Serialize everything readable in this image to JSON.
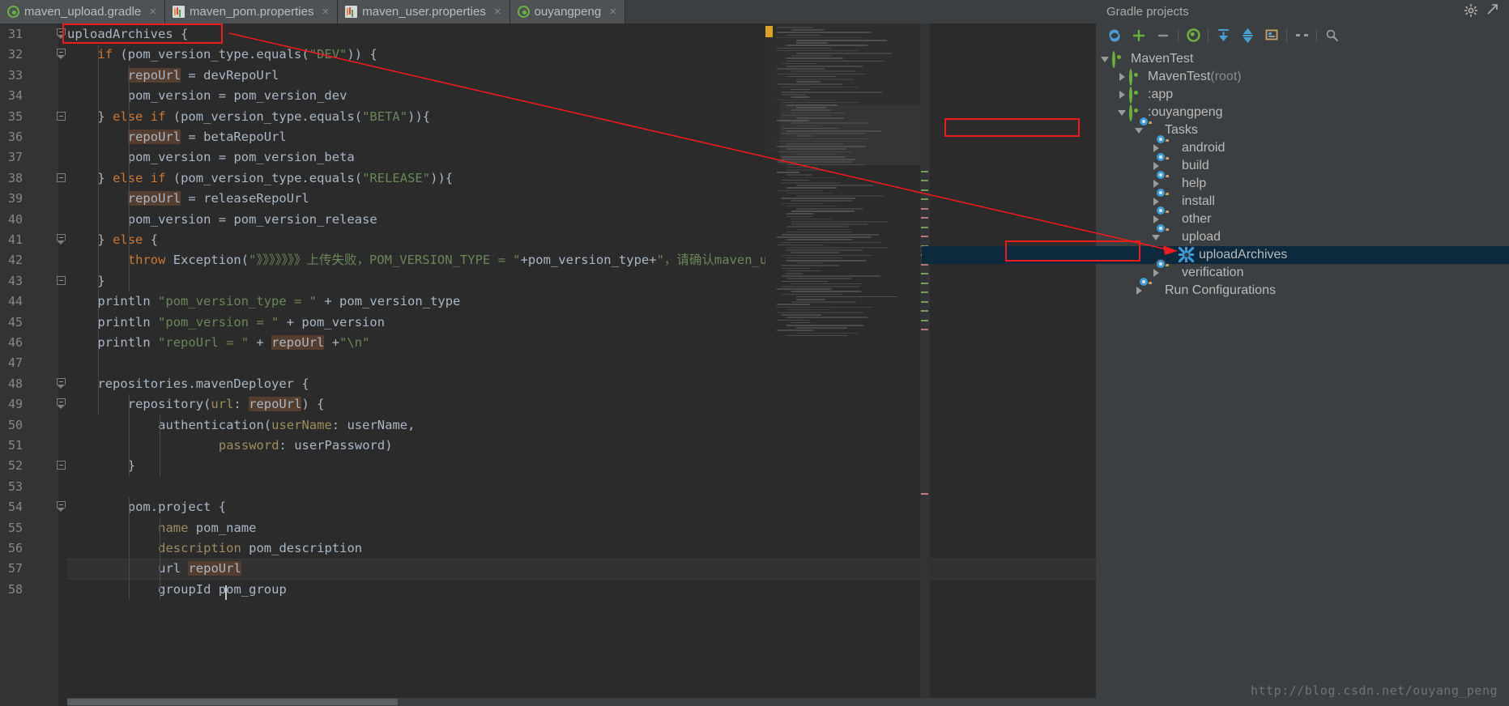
{
  "window": {
    "editor_background": "#2b2b2b",
    "panel_background": "#3c3f41",
    "accent_selection": "#0d293e",
    "annotation_color": "#ee1c1c"
  },
  "tabs": [
    {
      "label": "maven_upload.gradle",
      "icon": "gradle-file-icon",
      "close": "×",
      "active": true
    },
    {
      "label": "maven_pom.properties",
      "icon": "properties-file-icon",
      "close": "×",
      "active": false
    },
    {
      "label": "maven_user.properties",
      "icon": "properties-file-icon",
      "close": "×",
      "active": false
    },
    {
      "label": "ouyangpeng",
      "icon": "gradle-file-icon",
      "close": "×",
      "active": false
    }
  ],
  "editor": {
    "first_line_number": 31,
    "caret_line": 57,
    "lines": [
      {
        "n": 31,
        "fold": "open",
        "text": "uploadArchives {"
      },
      {
        "n": 32,
        "fold": "open",
        "text": "    if (pom_version_type.equals(\"DEV\")) {"
      },
      {
        "n": 33,
        "fold": "none",
        "text": "        repoUrl = devRepoUrl"
      },
      {
        "n": 34,
        "fold": "none",
        "text": "        pom_version = pom_version_dev"
      },
      {
        "n": 35,
        "fold": "minus",
        "text": "    } else if (pom_version_type.equals(\"BETA\")){"
      },
      {
        "n": 36,
        "fold": "none",
        "text": "        repoUrl = betaRepoUrl"
      },
      {
        "n": 37,
        "fold": "none",
        "text": "        pom_version = pom_version_beta"
      },
      {
        "n": 38,
        "fold": "minus",
        "text": "    } else if (pom_version_type.equals(\"RELEASE\")){"
      },
      {
        "n": 39,
        "fold": "none",
        "text": "        repoUrl = releaseRepoUrl"
      },
      {
        "n": 40,
        "fold": "none",
        "text": "        pom_version = pom_version_release"
      },
      {
        "n": 41,
        "fold": "open",
        "text": "    } else {"
      },
      {
        "n": 42,
        "fold": "none",
        "text": "        throw Exception(\"》》》》》》》上传失败，POM_VERSION_TYPE = \"+pom_version_type+\"，请确认maven_use"
      },
      {
        "n": 43,
        "fold": "minus",
        "text": "    }"
      },
      {
        "n": 44,
        "fold": "none",
        "text": "    println \"pom_version_type = \" + pom_version_type"
      },
      {
        "n": 45,
        "fold": "none",
        "text": "    println \"pom_version = \" + pom_version"
      },
      {
        "n": 46,
        "fold": "none",
        "text": "    println \"repoUrl = \" + repoUrl +\"\\n\""
      },
      {
        "n": 47,
        "fold": "none",
        "text": ""
      },
      {
        "n": 48,
        "fold": "open",
        "text": "    repositories.mavenDeployer {"
      },
      {
        "n": 49,
        "fold": "open",
        "text": "        repository(url: repoUrl) {"
      },
      {
        "n": 50,
        "fold": "none",
        "text": "            authentication(userName: userName,"
      },
      {
        "n": 51,
        "fold": "none",
        "text": "                    password: userPassword)"
      },
      {
        "n": 52,
        "fold": "minus",
        "text": "        }"
      },
      {
        "n": 53,
        "fold": "none",
        "text": ""
      },
      {
        "n": 54,
        "fold": "open",
        "text": "        pom.project {"
      },
      {
        "n": 55,
        "fold": "none",
        "text": "            name pom_name"
      },
      {
        "n": 56,
        "fold": "none",
        "text": "            description pom_description"
      },
      {
        "n": 57,
        "fold": "none",
        "text": "            url repoUrl"
      },
      {
        "n": 58,
        "fold": "none",
        "text": "            groupId pom_group"
      }
    ]
  },
  "gradle_panel": {
    "title": "Gradle projects",
    "header_buttons": [
      {
        "name": "settings-gear-icon",
        "glyph": "⚙"
      },
      {
        "name": "collapse-panel-icon",
        "glyph": "⇲"
      }
    ],
    "toolbar": [
      {
        "name": "refresh-all-projects-icon",
        "glyph": "↺",
        "color": "#4a9fd4"
      },
      {
        "name": "attach-gradle-project-icon",
        "glyph": "+",
        "color": "#6aaf3f"
      },
      {
        "name": "detach-project-icon",
        "glyph": "—",
        "color": "#9a9a9a"
      },
      {
        "name": "execute-gradle-task-icon",
        "glyph": "◉",
        "color": "#6aaf3f"
      },
      {
        "name": "expand-all-icon",
        "glyph": "⤓",
        "color": "#4a9fd4"
      },
      {
        "name": "collapse-all-icon",
        "glyph": "⤒",
        "color": "#4a9fd4"
      },
      {
        "name": "show-diagram-icon",
        "glyph": "▣",
        "color": "#c9a464"
      },
      {
        "name": "toggle-offline-mode-icon",
        "glyph": "↔",
        "color": "#9a9a9a"
      },
      {
        "name": "gradle-settings-icon",
        "glyph": "⚙",
        "color": "#9a9a9a"
      }
    ],
    "tree": [
      {
        "label": "MavenTest",
        "suffix": "",
        "depth": 0,
        "twisty": "down",
        "icon": "gradle-project-icon",
        "selected": false
      },
      {
        "label": "MavenTest",
        "suffix": " (root)",
        "depth": 1,
        "twisty": "right",
        "icon": "gradle-project-icon",
        "selected": false
      },
      {
        "label": ":app",
        "suffix": "",
        "depth": 1,
        "twisty": "right",
        "icon": "gradle-project-icon",
        "selected": false
      },
      {
        "label": ":ouyangpeng",
        "suffix": "",
        "depth": 1,
        "twisty": "down",
        "icon": "gradle-project-icon",
        "selected": false
      },
      {
        "label": "Tasks",
        "suffix": "",
        "depth": 2,
        "twisty": "down",
        "icon": "task-folder-icon",
        "selected": false,
        "annotated": true
      },
      {
        "label": "android",
        "suffix": "",
        "depth": 3,
        "twisty": "right",
        "icon": "task-folder-icon",
        "selected": false
      },
      {
        "label": "build",
        "suffix": "",
        "depth": 3,
        "twisty": "right",
        "icon": "task-folder-icon",
        "selected": false
      },
      {
        "label": "help",
        "suffix": "",
        "depth": 3,
        "twisty": "right",
        "icon": "task-folder-icon",
        "selected": false
      },
      {
        "label": "install",
        "suffix": "",
        "depth": 3,
        "twisty": "right",
        "icon": "task-folder-icon",
        "selected": false
      },
      {
        "label": "other",
        "suffix": "",
        "depth": 3,
        "twisty": "right",
        "icon": "task-folder-icon",
        "selected": false
      },
      {
        "label": "upload",
        "suffix": "",
        "depth": 3,
        "twisty": "down",
        "icon": "task-folder-icon",
        "selected": false
      },
      {
        "label": "uploadArchives",
        "suffix": "",
        "depth": 4,
        "twisty": "none",
        "icon": "gradle-task-icon",
        "selected": true,
        "annotated": true
      },
      {
        "label": "verification",
        "suffix": "",
        "depth": 3,
        "twisty": "right",
        "icon": "task-folder-icon",
        "selected": false
      },
      {
        "label": "Run Configurations",
        "suffix": "",
        "depth": 2,
        "twisty": "right",
        "icon": "task-folder-icon",
        "selected": false
      }
    ]
  },
  "annotations": {
    "box_code_label": "uploadArchives {",
    "box_tasks_label": "Tasks",
    "box_task_label": "uploadArchives",
    "arrow_description": "red arrow from code declaration to uploadArchives task"
  },
  "watermark": {
    "text": "http://blog.csdn.net/ouyang_peng"
  }
}
